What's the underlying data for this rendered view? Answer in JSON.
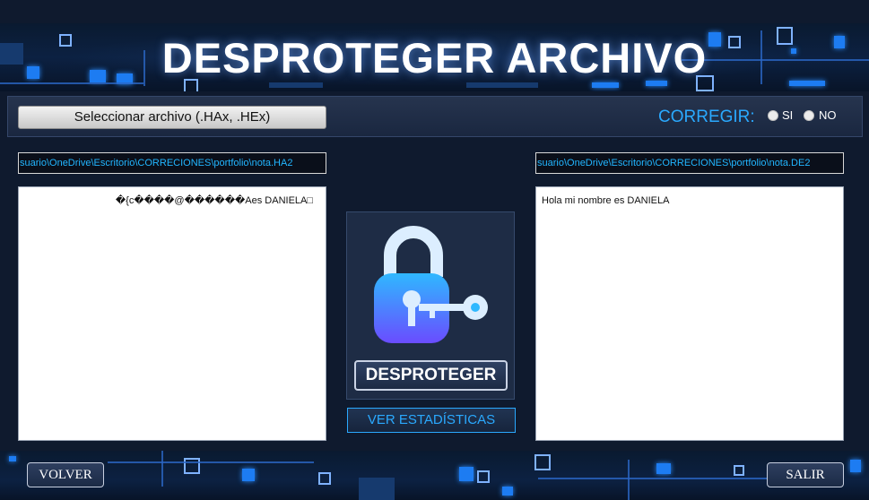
{
  "header": {
    "title": "DESPROTEGER ARCHIVO"
  },
  "toolbar": {
    "select_file_label": "Seleccionar archivo (.HAx, .HEx)",
    "corregir_label": "CORREGIR:",
    "options": [
      {
        "label": "SI",
        "selected": false
      },
      {
        "label": "NO",
        "selected": false
      }
    ]
  },
  "source": {
    "path": "suario\\OneDrive\\Escritorio\\CORRECIONES\\portfolio\\nota.HA2",
    "content": "�{c����@������Aes DANIELA□"
  },
  "output": {
    "path": "suario\\OneDrive\\Escritorio\\CORRECIONES\\portfolio\\nota.DE2",
    "content": "Hola mi nombre es DANIELA"
  },
  "center": {
    "icon": "lock-key-icon",
    "action_label": "DESPROTEGER",
    "stats_label": "VER ESTADÍSTICAS"
  },
  "footer": {
    "back_label": "VOLVER",
    "exit_label": "SALIR"
  },
  "colors": {
    "accent": "#2aa9ff",
    "background": "#0f1a2e",
    "lock_gradient_top": "#2fb8ff",
    "lock_gradient_bottom": "#6a4cff"
  }
}
